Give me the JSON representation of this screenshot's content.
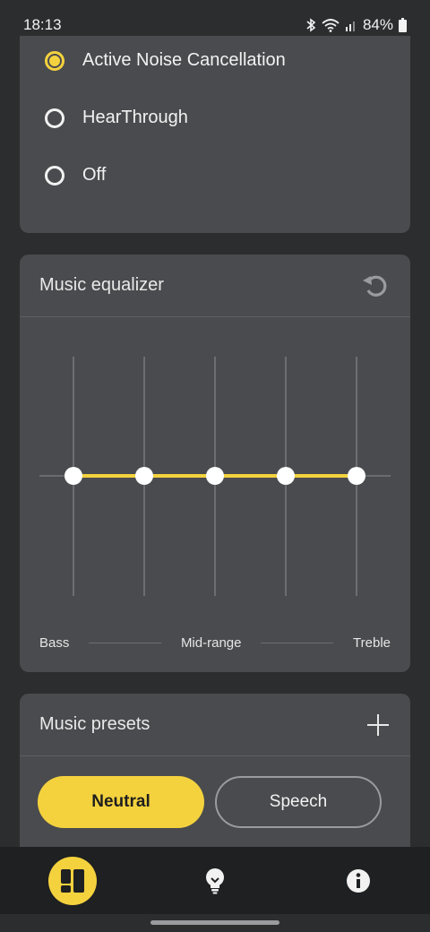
{
  "status": {
    "time": "18:13",
    "battery": "84%"
  },
  "anc": {
    "options": [
      {
        "label": "Active Noise Cancellation",
        "selected": true
      },
      {
        "label": "HearThrough",
        "selected": false
      },
      {
        "label": "Off",
        "selected": false
      }
    ]
  },
  "equalizer": {
    "title": "Music equalizer",
    "bands": [
      0,
      0,
      0,
      0,
      0
    ],
    "labels": {
      "bass": "Bass",
      "mid": "Mid-range",
      "treble": "Treble"
    }
  },
  "presets": {
    "title": "Music presets",
    "items": [
      {
        "label": "Neutral",
        "active": true
      },
      {
        "label": "Speech",
        "active": false
      }
    ]
  },
  "colors": {
    "accent": "#f4d23e",
    "card": "#4a4b4e",
    "background": "#2c2d2f"
  },
  "nav": {
    "items": [
      "dashboard-icon",
      "lightbulb-icon",
      "info-icon"
    ]
  }
}
